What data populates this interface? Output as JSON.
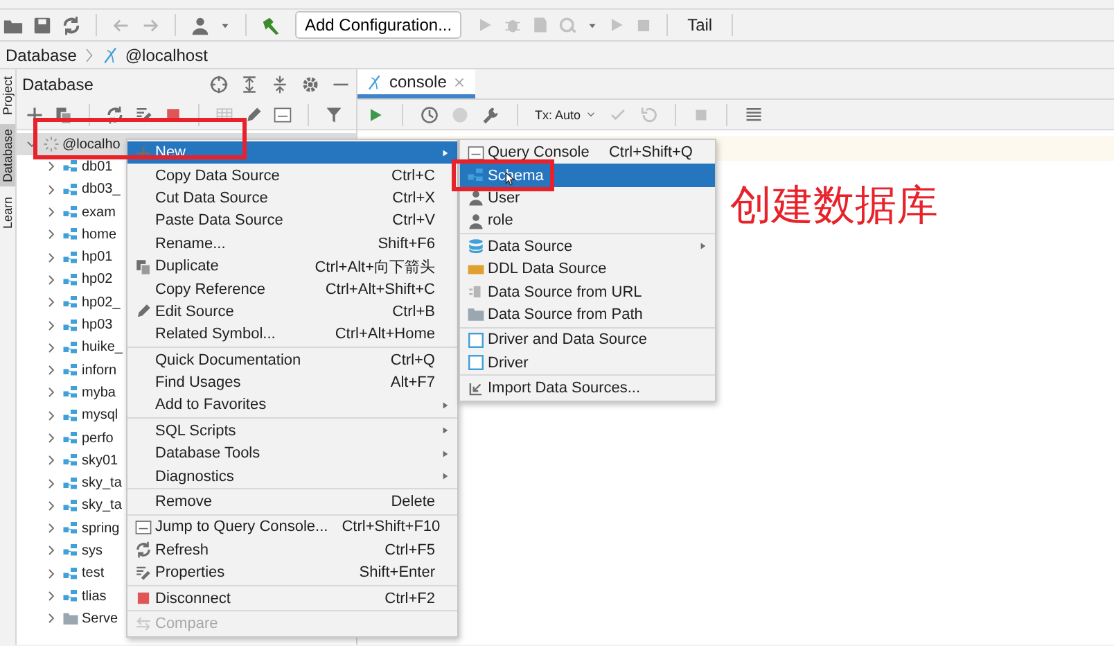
{
  "toolbar": {
    "run_config": "Add Configuration...",
    "tail": "Tail"
  },
  "breadcrumb": [
    "Database",
    "@localhost"
  ],
  "side_tabs": [
    {
      "label": "Project",
      "selected": false
    },
    {
      "label": "Database",
      "selected": true
    },
    {
      "label": "Learn",
      "selected": false
    }
  ],
  "database_panel": {
    "title": "Database",
    "tree": [
      {
        "name": "@localho",
        "kind": "host",
        "expanded": true,
        "children": [
          {
            "name": "db01",
            "kind": "schema",
            "expanded": false
          },
          {
            "name": "db03_",
            "kind": "schema",
            "expanded": false
          },
          {
            "name": "exam",
            "kind": "schema",
            "expanded": false
          },
          {
            "name": "home",
            "kind": "schema",
            "expanded": false
          },
          {
            "name": "hp01",
            "kind": "schema",
            "expanded": false
          },
          {
            "name": "hp02",
            "kind": "schema",
            "expanded": false
          },
          {
            "name": "hp02_",
            "kind": "schema",
            "expanded": false
          },
          {
            "name": "hp03",
            "kind": "schema",
            "expanded": false
          },
          {
            "name": "huike_",
            "kind": "schema",
            "expanded": false
          },
          {
            "name": "inforn",
            "kind": "schema",
            "expanded": false
          },
          {
            "name": "myba",
            "kind": "schema",
            "expanded": false
          },
          {
            "name": "mysql",
            "kind": "schema",
            "expanded": false
          },
          {
            "name": "perfo",
            "kind": "schema",
            "expanded": false
          },
          {
            "name": "sky01",
            "kind": "schema",
            "expanded": false
          },
          {
            "name": "sky_ta",
            "kind": "schema",
            "expanded": false
          },
          {
            "name": "sky_ta",
            "kind": "schema",
            "expanded": false
          },
          {
            "name": "spring",
            "kind": "schema",
            "expanded": false
          },
          {
            "name": "sys",
            "kind": "schema",
            "expanded": false
          },
          {
            "name": "test",
            "kind": "schema",
            "expanded": false
          },
          {
            "name": "tlias",
            "kind": "schema",
            "expanded": false
          },
          {
            "name": "Serve",
            "kind": "folder",
            "expanded": false
          }
        ]
      }
    ]
  },
  "editor_tabs": [
    {
      "label": "console",
      "selected": true
    }
  ],
  "console_toolbar": {
    "transaction": "Tx: Auto"
  },
  "context_menu": {
    "items": [
      {
        "kind": "item",
        "label": "New",
        "submenu": true,
        "highlighted": true,
        "disabled": false
      },
      {
        "kind": "item",
        "label": "Copy Data Source",
        "shortcut": "Ctrl+C",
        "highlighted": false,
        "disabled": false
      },
      {
        "kind": "item",
        "label": "Cut Data Source",
        "shortcut": "Ctrl+X",
        "highlighted": false,
        "disabled": false
      },
      {
        "kind": "item",
        "label": "Paste Data Source",
        "shortcut": "Ctrl+V",
        "highlighted": false,
        "disabled": false
      },
      {
        "kind": "item",
        "label": "Rename...",
        "shortcut": "Shift+F6",
        "highlighted": false,
        "disabled": false
      },
      {
        "kind": "item",
        "label": "Duplicate",
        "shortcut": "Ctrl+Alt+向下箭头",
        "highlighted": false,
        "disabled": false
      },
      {
        "kind": "item",
        "label": "Copy Reference",
        "shortcut": "Ctrl+Alt+Shift+C",
        "highlighted": false,
        "disabled": false
      },
      {
        "kind": "item",
        "label": "Edit Source",
        "shortcut": "Ctrl+B",
        "highlighted": false,
        "disabled": false
      },
      {
        "kind": "item",
        "label": "Related Symbol...",
        "shortcut": "Ctrl+Alt+Home",
        "highlighted": false,
        "disabled": false
      },
      {
        "kind": "separator"
      },
      {
        "kind": "item",
        "label": "Quick Documentation",
        "shortcut": "Ctrl+Q",
        "highlighted": false,
        "disabled": false
      },
      {
        "kind": "item",
        "label": "Find Usages",
        "shortcut": "Alt+F7",
        "highlighted": false,
        "disabled": false
      },
      {
        "kind": "item",
        "label": "Add to Favorites",
        "submenu": true,
        "highlighted": false,
        "disabled": false
      },
      {
        "kind": "separator"
      },
      {
        "kind": "item",
        "label": "SQL Scripts",
        "submenu": true,
        "highlighted": false,
        "disabled": false
      },
      {
        "kind": "item",
        "label": "Database Tools",
        "submenu": true,
        "highlighted": false,
        "disabled": false
      },
      {
        "kind": "item",
        "label": "Diagnostics",
        "submenu": true,
        "highlighted": false,
        "disabled": false
      },
      {
        "kind": "separator"
      },
      {
        "kind": "item",
        "label": "Remove",
        "shortcut": "Delete",
        "highlighted": false,
        "disabled": false
      },
      {
        "kind": "separator"
      },
      {
        "kind": "item",
        "label": "Jump to Query Console...",
        "shortcut": "Ctrl+Shift+F10",
        "highlighted": false,
        "disabled": false
      },
      {
        "kind": "item",
        "label": "Refresh",
        "shortcut": "Ctrl+F5",
        "highlighted": false,
        "disabled": false
      },
      {
        "kind": "item",
        "label": "Properties",
        "shortcut": "Shift+Enter",
        "highlighted": false,
        "disabled": false
      },
      {
        "kind": "separator"
      },
      {
        "kind": "item",
        "label": "Disconnect",
        "shortcut": "Ctrl+F2",
        "highlighted": false,
        "disabled": false
      },
      {
        "kind": "separator"
      },
      {
        "kind": "item",
        "label": "Compare",
        "highlighted": false,
        "disabled": true
      }
    ]
  },
  "new_submenu": {
    "items": [
      {
        "kind": "item",
        "label": "Query Console",
        "shortcut": "Ctrl+Shift+Q",
        "highlighted": false,
        "disabled": false
      },
      {
        "kind": "item",
        "label": "Schema",
        "highlighted": true,
        "disabled": false
      },
      {
        "kind": "item",
        "label": "User",
        "highlighted": false,
        "disabled": false
      },
      {
        "kind": "item",
        "label": "role",
        "highlighted": false,
        "disabled": false
      },
      {
        "kind": "separator"
      },
      {
        "kind": "item",
        "label": "Data Source",
        "submenu": true,
        "highlighted": false,
        "disabled": false
      },
      {
        "kind": "item",
        "label": "DDL Data Source",
        "highlighted": false,
        "disabled": false
      },
      {
        "kind": "item",
        "label": "Data Source from URL",
        "highlighted": false,
        "disabled": false
      },
      {
        "kind": "item",
        "label": "Data Source from Path",
        "highlighted": false,
        "disabled": false
      },
      {
        "kind": "separator"
      },
      {
        "kind": "item",
        "label": "Driver and Data Source",
        "highlighted": false,
        "disabled": false
      },
      {
        "kind": "item",
        "label": "Driver",
        "highlighted": false,
        "disabled": false
      },
      {
        "kind": "separator"
      },
      {
        "kind": "item",
        "label": "Import Data Sources...",
        "highlighted": false,
        "disabled": false
      }
    ]
  },
  "annotation": {
    "text": "创建数据库"
  }
}
